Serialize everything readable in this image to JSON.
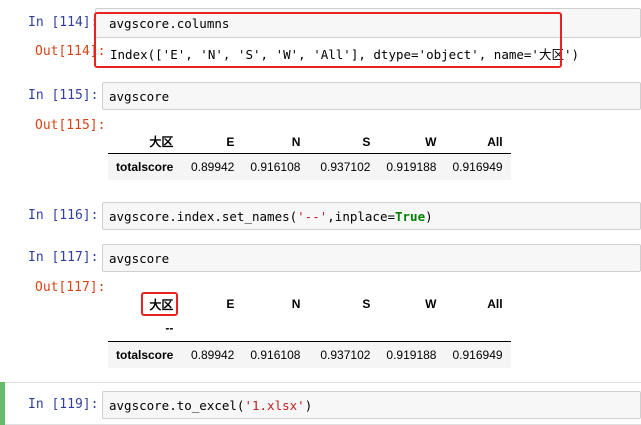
{
  "cells": {
    "c114": {
      "in_label": "In",
      "in_num": "[114]:",
      "out_label": "Out[114]:",
      "code": "avgscore.columns",
      "output": "Index(['E', 'N', 'S', 'W', 'All'], dtype='object', name='大区')"
    },
    "c115": {
      "in_label": "In",
      "in_num": "[115]:",
      "out_label": "Out[115]:",
      "code": "avgscore"
    },
    "c116": {
      "in_label": "In",
      "in_num": "[116]:",
      "code_pre": "avgscore.index.set_names(",
      "code_str": "'--'",
      "code_mid": ",inplace=",
      "code_kw": "True",
      "code_post": ")"
    },
    "c117": {
      "in_label": "In",
      "in_num": "[117]:",
      "out_label": "Out[117]:",
      "code": "avgscore",
      "index_name": "--"
    },
    "c119": {
      "in_label": "In",
      "in_num": "[119]:",
      "code_pre": "avgscore.to_excel(",
      "code_str": "'1.xlsx'",
      "code_post": ")"
    }
  },
  "dataframe": {
    "columns_name": "大区",
    "columns": [
      "E",
      "N",
      "S",
      "W",
      "All"
    ],
    "row_label": "totalscore",
    "values": [
      "0.89942",
      "0.916108",
      "0.937102",
      "0.919188",
      "0.916949"
    ]
  },
  "colors": {
    "prompt_in": "#303f9f",
    "prompt_out": "#d84315",
    "highlight_box": "#e8231f",
    "selected_cell_bar": "#66bb6a"
  }
}
